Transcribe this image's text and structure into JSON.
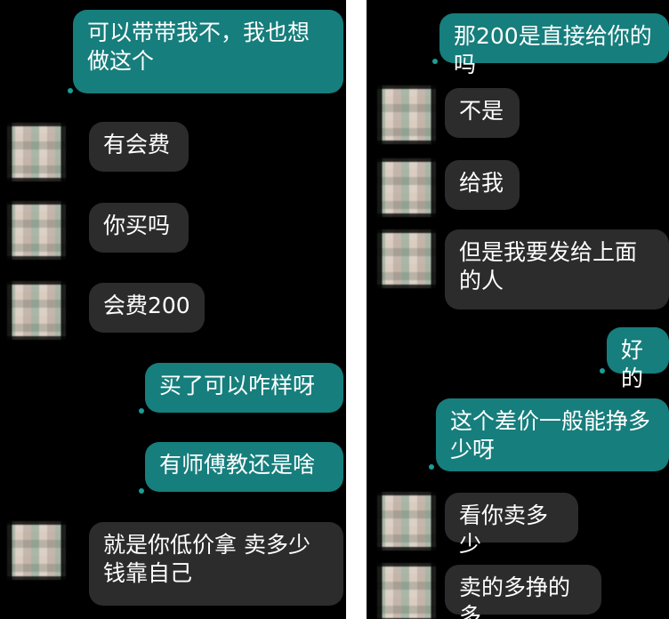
{
  "left_chat": {
    "messages": [
      {
        "sender": "me",
        "text": "可以带带我不，我也想做这个"
      },
      {
        "sender": "other",
        "text": "有会费"
      },
      {
        "sender": "other",
        "text": "你买吗"
      },
      {
        "sender": "other",
        "text": "会费200"
      },
      {
        "sender": "me",
        "text": "买了可以咋样呀"
      },
      {
        "sender": "me",
        "text": "有师傅教还是啥"
      },
      {
        "sender": "other",
        "text": "就是你低价拿 卖多少钱靠自己"
      }
    ]
  },
  "right_chat": {
    "messages": [
      {
        "sender": "me",
        "text": "那200是直接给你的吗"
      },
      {
        "sender": "other",
        "text": "不是"
      },
      {
        "sender": "other",
        "text": "给我"
      },
      {
        "sender": "other",
        "text": "但是我要发给上面的人"
      },
      {
        "sender": "me",
        "text": "好的"
      },
      {
        "sender": "me",
        "text": "这个差价一般能挣多少呀"
      },
      {
        "sender": "other",
        "text": "看你卖多少"
      },
      {
        "sender": "other",
        "text": "卖的多挣的多"
      }
    ]
  },
  "colors": {
    "background": "#000000",
    "outgoing_bubble": "#167e7c",
    "incoming_bubble": "#2c2c2c",
    "text": "#ffffff",
    "read_dot": "#1a9e97"
  }
}
